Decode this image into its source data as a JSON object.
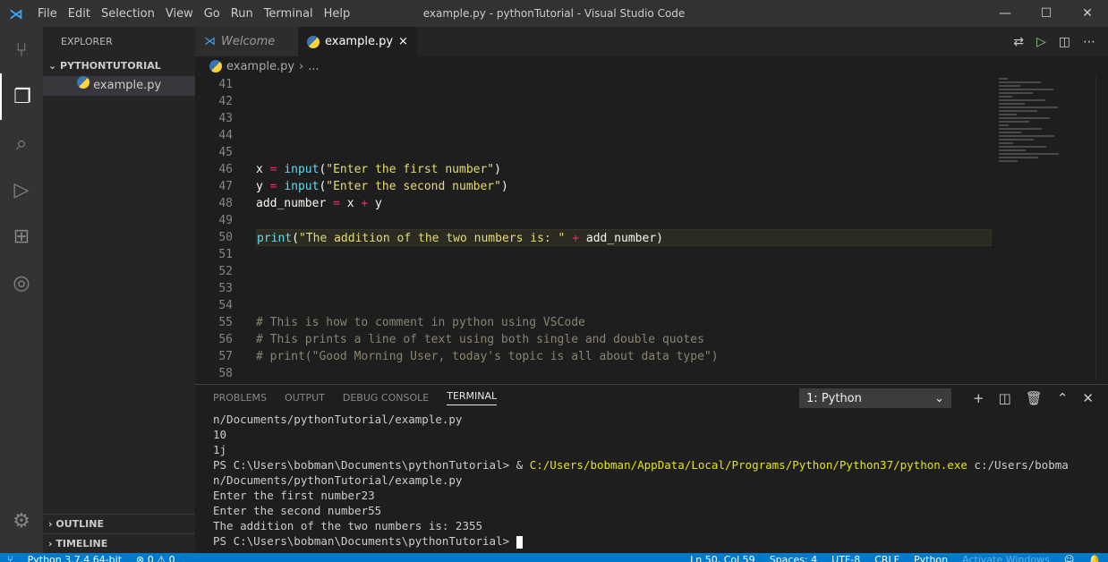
{
  "titlebar": {
    "menu": [
      "File",
      "Edit",
      "Selection",
      "View",
      "Go",
      "Run",
      "Terminal",
      "Help"
    ],
    "title": "example.py - pythonTutorial - Visual Studio Code"
  },
  "sidebar": {
    "title": "EXPLORER",
    "folder": "PYTHONTUTORIAL",
    "file": "example.py",
    "outline": "OUTLINE",
    "timeline": "TIMELINE"
  },
  "tabs": [
    {
      "label": "Welcome"
    },
    {
      "label": "example.py",
      "close": "×"
    }
  ],
  "breadcrumb": {
    "file": "example.py",
    "sep": "›",
    "more": "..."
  },
  "editor": {
    "lines": [
      {
        "n": "41",
        "tokens": []
      },
      {
        "n": "42",
        "tokens": []
      },
      {
        "n": "43",
        "tokens": []
      },
      {
        "n": "44",
        "tokens": []
      },
      {
        "n": "45",
        "tokens": []
      },
      {
        "n": "46",
        "tokens": [
          [
            "var",
            "x "
          ],
          [
            "op",
            "="
          ],
          [
            "p",
            " "
          ],
          [
            "fn",
            "input"
          ],
          [
            "p",
            "("
          ],
          [
            "str",
            "\"Enter the first number\""
          ],
          [
            "p",
            ")"
          ]
        ]
      },
      {
        "n": "47",
        "tokens": [
          [
            "var",
            "y "
          ],
          [
            "op",
            "="
          ],
          [
            "p",
            " "
          ],
          [
            "fn",
            "input"
          ],
          [
            "p",
            "("
          ],
          [
            "str",
            "\"Enter the second number\""
          ],
          [
            "p",
            ")"
          ]
        ]
      },
      {
        "n": "48",
        "tokens": [
          [
            "var",
            "add_number "
          ],
          [
            "op",
            "="
          ],
          [
            "var",
            " x "
          ],
          [
            "op",
            "+"
          ],
          [
            "var",
            " y"
          ]
        ]
      },
      {
        "n": "49",
        "tokens": []
      },
      {
        "n": "50",
        "current": true,
        "tokens": [
          [
            "fn",
            "print"
          ],
          [
            "p",
            "("
          ],
          [
            "str",
            "\"The addition of the two numbers is: \""
          ],
          [
            "p",
            " "
          ],
          [
            "op",
            "+"
          ],
          [
            "var",
            " add_number"
          ],
          [
            "p",
            ")"
          ]
        ]
      },
      {
        "n": "51",
        "tokens": []
      },
      {
        "n": "52",
        "tokens": []
      },
      {
        "n": "53",
        "tokens": []
      },
      {
        "n": "54",
        "tokens": []
      },
      {
        "n": "55",
        "tokens": [
          [
            "cm",
            "# This is how to comment in python using VSCode"
          ]
        ]
      },
      {
        "n": "56",
        "tokens": [
          [
            "cm",
            "# This prints a line of text using both single and double quotes"
          ]
        ]
      },
      {
        "n": "57",
        "tokens": [
          [
            "cm",
            "# print(\"Good Morning User, today's topic is all about data type\")"
          ]
        ]
      },
      {
        "n": "58",
        "tokens": []
      }
    ]
  },
  "panel": {
    "tabs": [
      "PROBLEMS",
      "OUTPUT",
      "DEBUG CONSOLE",
      "TERMINAL"
    ],
    "active_tab": "TERMINAL",
    "terminal_select": "1: Python",
    "terminal_lines": [
      [
        "n/Documents/pythonTutorial/example.py"
      ],
      [
        "10"
      ],
      [
        "1j"
      ],
      [
        "PS C:\\Users\\bobman\\Documents\\pythonTutorial> & ",
        "C:/Users/bobman/AppData/Local/Programs/Python/Python37/python.exe",
        " c:/Users/bobma"
      ],
      [
        "n/Documents/pythonTutorial/example.py"
      ],
      [
        "Enter the first number23"
      ],
      [
        "Enter the second number55"
      ],
      [
        "The addition of the two numbers is: 2355"
      ],
      [
        "PS C:\\Users\\bobman\\Documents\\pythonTutorial> "
      ]
    ]
  },
  "statusbar": {
    "interpreter": "Python 3.7.4 64-bit",
    "problems": "⊗ 0 ⚠ 0",
    "position": "Ln 50, Col 59",
    "spaces": "Spaces: 4",
    "encoding": "UTF-8",
    "eol": "CRLF",
    "language": "Python",
    "watermark": "Activate Windows"
  }
}
